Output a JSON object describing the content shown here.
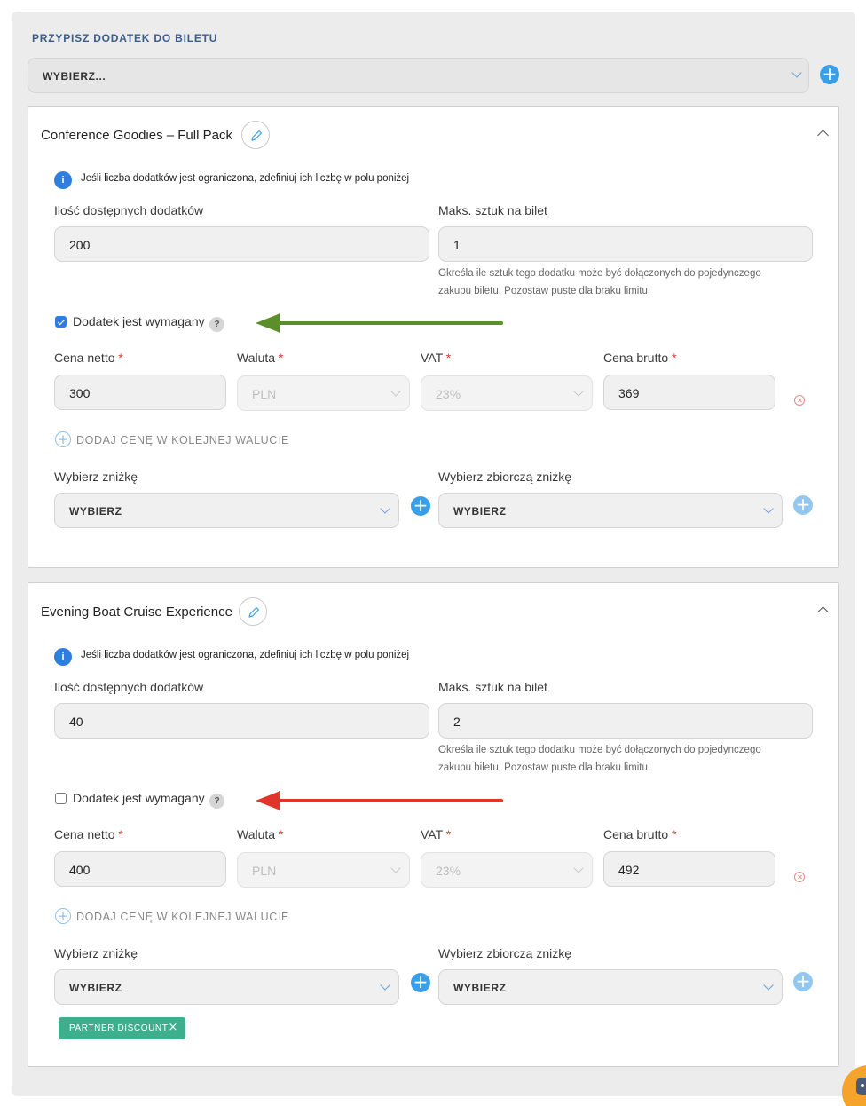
{
  "header": {
    "title": "PRZYPISZ DODATEK DO BILETU",
    "select_placeholder": "WYBIERZ..."
  },
  "addons": [
    {
      "name": "Conference Goodies – Full Pack",
      "info": "Jeśli liczba dodatków jest ograniczona, zdefiniuj ich liczbę w polu poniżej",
      "quantity_label": "Ilość dostępnych dodatków",
      "quantity_value": "200",
      "max_label": "Maks. sztuk na bilet",
      "max_value": "1",
      "max_help_line1": "Określa ile sztuk tego dodatku może być dołączonych do pojedynczego",
      "max_help_line2": "zakupu biletu. Pozostaw puste dla braku limitu.",
      "required_label": "Dodatek jest wymagany",
      "required_checked": true,
      "help_mark": "?",
      "net_label": "Cena netto",
      "net_value": "300",
      "currency_label": "Waluta",
      "currency_value": "PLN",
      "vat_label": "VAT",
      "vat_value": "23%",
      "gross_label": "Cena brutto",
      "gross_value": "369",
      "required_mark": "*",
      "add_currency": "DODAJ CENĘ W KOLEJNEJ WALUCIE",
      "discount_label": "Wybierz zniżkę",
      "discount_value": "WYBIERZ",
      "bulk_discount_label": "Wybierz zbiorczą zniżkę",
      "bulk_discount_value": "WYBIERZ",
      "tags": []
    },
    {
      "name": "Evening Boat Cruise Experience",
      "info": "Jeśli liczba dodatków jest ograniczona, zdefiniuj ich liczbę w polu poniżej",
      "quantity_label": "Ilość dostępnych dodatków",
      "quantity_value": "40",
      "max_label": "Maks. sztuk na bilet",
      "max_value": "2",
      "max_help_line1": "Określa ile sztuk tego dodatku może być dołączonych do pojedynczego",
      "max_help_line2": "zakupu biletu. Pozostaw puste dla braku limitu.",
      "required_label": "Dodatek jest wymagany",
      "required_checked": false,
      "help_mark": "?",
      "net_label": "Cena netto",
      "net_value": "400",
      "currency_label": "Waluta",
      "currency_value": "PLN",
      "vat_label": "VAT",
      "vat_value": "23%",
      "gross_label": "Cena brutto",
      "gross_value": "492",
      "required_mark": "*",
      "add_currency": "DODAJ CENĘ W KOLEJNEJ WALUCIE",
      "discount_label": "Wybierz zniżkę",
      "discount_value": "WYBIERZ",
      "bulk_discount_label": "Wybierz zbiorczą zniżkę",
      "bulk_discount_value": "WYBIERZ",
      "tags": [
        "PARTNER DISCOUNT"
      ]
    }
  ],
  "colors": {
    "accent_blue": "#3a9fe8",
    "arrow_green": "#5a8f2a",
    "arrow_red": "#e0352b",
    "tag_green": "#3fae8c",
    "title_blue": "#3a5d8c"
  },
  "icons": {
    "add": "plus-circle-icon",
    "edit": "pencil-icon",
    "collapse": "chevron-up-icon",
    "dropdown": "chevron-down-icon",
    "info": "info-icon",
    "remove": "remove-circle-icon",
    "help": "question-icon",
    "annotation_arrow": "left-arrow-icon"
  }
}
